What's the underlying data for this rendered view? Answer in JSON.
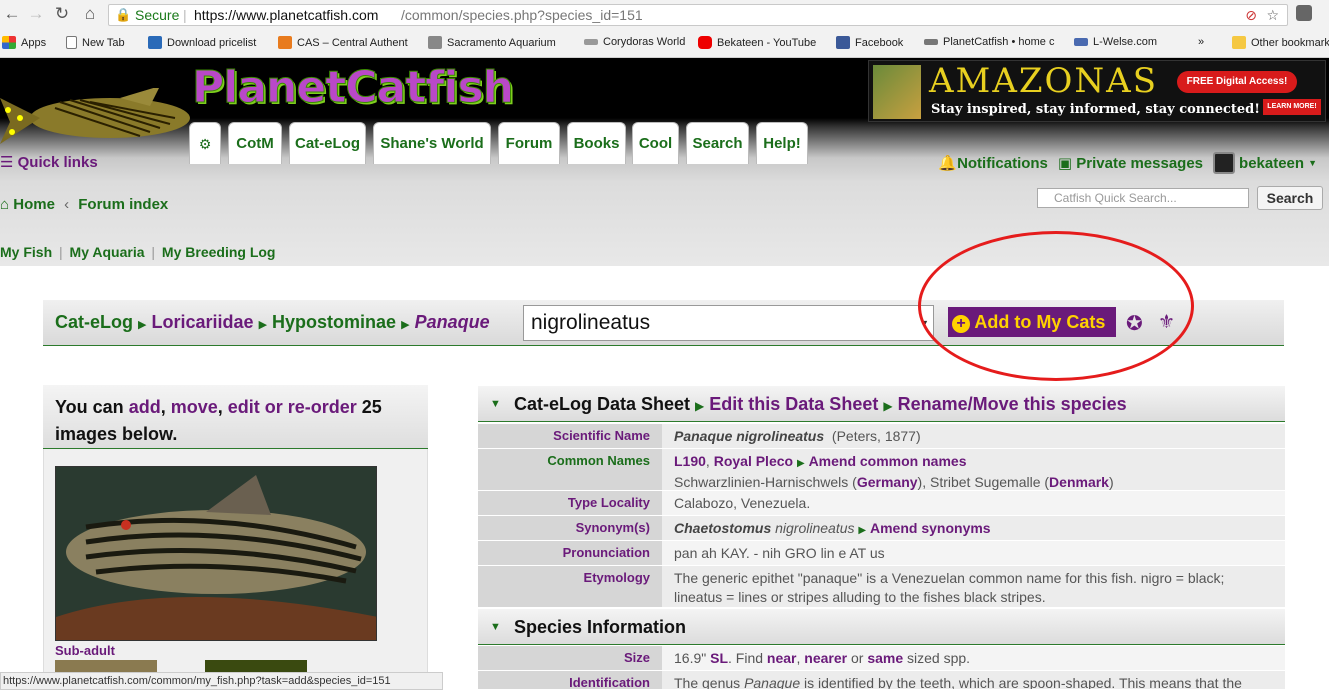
{
  "browser": {
    "secure_label": "Secure",
    "url_domain": "https://www.planetcatfish.com",
    "url_path": "/common/species.php?species_id=151",
    "bookmarks": [
      "Apps",
      "New Tab",
      "Download pricelist",
      "CAS – Central Authent",
      "Sacramento Aquarium",
      "Corydoras World",
      "Bekateen - YouTube",
      "Facebook",
      "PlanetCatfish • home c",
      "L-Welse.com",
      "Other bookmarks"
    ],
    "overflow": "»"
  },
  "site": {
    "logo": "PlanetCatfish",
    "banner": {
      "title": "AMAZONAS",
      "tagline": "Stay inspired, stay informed, stay connected!",
      "badge": "FREE Digital Access!",
      "learn": "LEARN MORE!"
    },
    "tabs": [
      "CotM",
      "Cat-eLog",
      "Shane's World",
      "Forum",
      "Books",
      "Cool",
      "Search",
      "Help!"
    ],
    "quick_links": "Quick links",
    "notifications": "Notifications",
    "private_messages": "Private messages",
    "username": "bekateen"
  },
  "subnav": {
    "home": "Home",
    "forum_index": "Forum index",
    "search_placeholder": "Catfish Quick Search...",
    "search_button": "Search",
    "my_fish": "My Fish",
    "my_aquaria": "My Aquaria",
    "my_breeding_log": "My Breeding Log"
  },
  "catalog": {
    "crumbs": [
      "Cat-eLog",
      "Loricariidae",
      "Hypostominae"
    ],
    "genus": "Panaque",
    "species": "nigrolineatus",
    "add_button": "Add to My Cats"
  },
  "images_panel": {
    "prefix": "You can ",
    "add": "add",
    "sep1": ", ",
    "move": "move",
    "sep2": ", ",
    "edit": "edit or re-order",
    "count": " 25",
    "suffix": "images below.",
    "caption": "Sub-adult"
  },
  "datasheet": {
    "title": "Cat-eLog Data Sheet",
    "edit_link": "Edit this Data Sheet",
    "rename_link": "Rename/Move this species",
    "rows": {
      "scientific": {
        "label": "Scientific Name",
        "value": "Panaque nigrolineatus",
        "author": "(Peters, 1877)"
      },
      "common": {
        "label": "Common Names",
        "l190": "L190",
        "sep": ", ",
        "royal": "Royal Pleco",
        "amend": "Amend common names",
        "line2_a": "Schwarzlinien-Harnischwels (",
        "germany": "Germany",
        "line2_b": "), Stribet Sugemalle (",
        "denmark": "Denmark",
        "line2_c": ")"
      },
      "locality": {
        "label": "Type Locality",
        "value": "Calabozo, Venezuela."
      },
      "synonyms": {
        "label": "Synonym(s)",
        "genus": "Chaetostomus",
        "species": " nigrolineatus",
        "amend": "Amend synonyms"
      },
      "pronunciation": {
        "label": "Pronunciation",
        "value": "pan ah KAY. - nih GRO lin e AT us"
      },
      "etymology": {
        "label": "Etymology",
        "value": "The generic epithet \"panaque\" is a Venezuelan common name for this fish. nigro = black; lineatus = lines or stripes alluding to the fishes black stripes."
      }
    },
    "species_info_title": "Species Information",
    "size": {
      "label": "Size",
      "value": "16.9\"",
      "unit": "SL",
      "text1": ". Find ",
      "near": "near",
      "sep1": ", ",
      "nearer": "nearer",
      "sep2": " or ",
      "same": "same",
      "text2": " sized spp."
    },
    "identification": {
      "label": "Identification",
      "a": "The genus ",
      "genus": "Panaque",
      "b": " is identified by the teeth, which are spoon-shaped. This means that the"
    }
  },
  "status_bar": "https://www.planetcatfish.com/common/my_fish.php?task=add&species_id=151",
  "colors": {
    "green": "#1b6e1b",
    "purple": "#6a1a7a",
    "annotation": "#e51c1c"
  }
}
